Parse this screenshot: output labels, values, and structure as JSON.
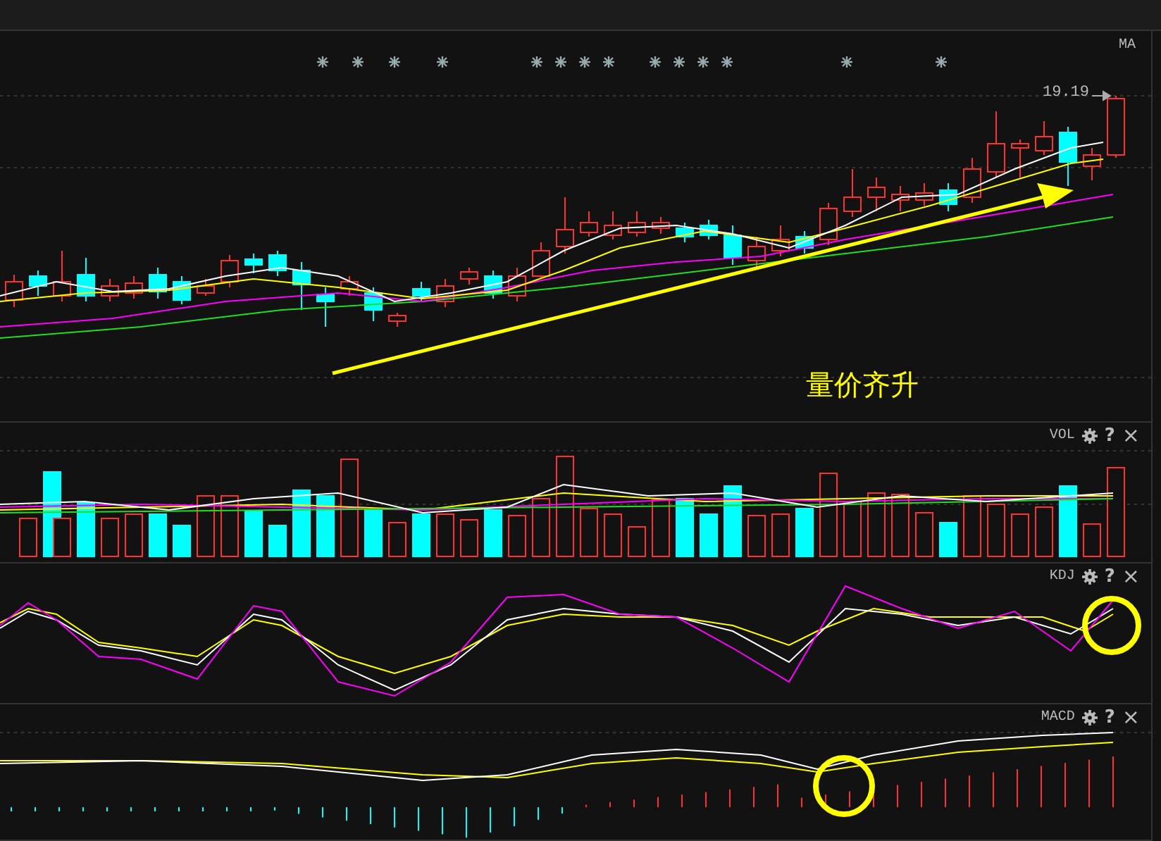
{
  "panels": [
    {
      "kind": "price",
      "label": "MA",
      "price_tag": "19.19",
      "annotation": "量价齐升"
    },
    {
      "kind": "volume",
      "label": "VOL",
      "help": "?",
      "close": "×"
    },
    {
      "kind": "kdj",
      "label": "KDJ",
      "help": "?",
      "close": "×"
    },
    {
      "kind": "macd",
      "label": "MACD",
      "help": "?",
      "close": "×"
    }
  ]
}
